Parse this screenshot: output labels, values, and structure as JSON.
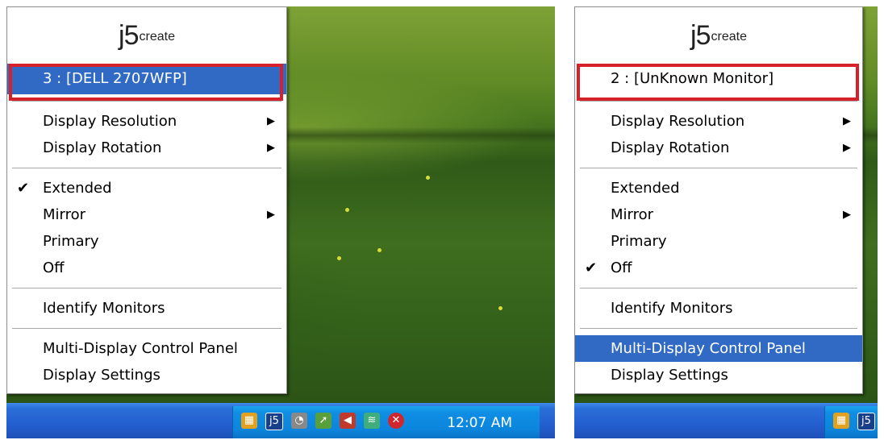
{
  "left": {
    "logo": {
      "part1": "j5",
      "part2": "create"
    },
    "monitor_label": "3 : [DELL 2707WFP]",
    "menu": {
      "display_resolution": "Display Resolution",
      "display_rotation": "Display Rotation",
      "extended": "Extended",
      "mirror": "Mirror",
      "primary": "Primary",
      "off": "Off",
      "identify_monitors": "Identify Monitors",
      "control_panel": "Multi-Display Control Panel",
      "display_settings": "Display Settings"
    },
    "checked": "extended",
    "tray": {
      "clock": "12:07 AM"
    }
  },
  "right": {
    "logo": {
      "part1": "j5",
      "part2": "create"
    },
    "monitor_label": "2 : [UnKnown Monitor]",
    "menu": {
      "display_resolution": "Display Resolution",
      "display_rotation": "Display Rotation",
      "extended": "Extended",
      "mirror": "Mirror",
      "primary": "Primary",
      "off": "Off",
      "identify_monitors": "Identify Monitors",
      "control_panel": "Multi-Display Control Panel",
      "display_settings": "Display Settings"
    },
    "checked": "off",
    "highlighted": "control_panel"
  },
  "glyphs": {
    "check": "✔",
    "submenu_arrow": "▶"
  },
  "colors": {
    "highlight": "#316ac5",
    "callout": "#d6202a",
    "taskbar": "#245fd0",
    "tray": "#0c86dd"
  }
}
